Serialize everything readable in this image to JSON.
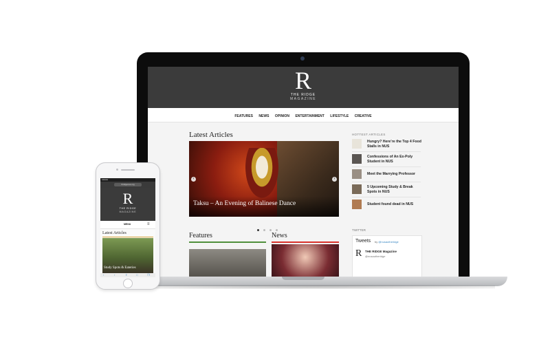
{
  "site": {
    "logo_letter": "R",
    "logo_title": "THE RIDGE",
    "logo_subtitle": "MAGAZINE"
  },
  "nav": [
    "FEATURES",
    "NEWS",
    "OPINION",
    "ENTERTAINMENT",
    "LIFESTYLE",
    "CREATIVE"
  ],
  "latest": {
    "heading": "Latest Articles",
    "hero_caption": "Taksu – An Evening of Balinese Dance",
    "prev_arrow": "‹",
    "next_arrow": "›",
    "slides": 4,
    "active_slide": 1
  },
  "sections": {
    "features": "Features",
    "news": "News"
  },
  "sidebar": {
    "hottest_heading": "HOTTEST ARTICLES",
    "hottest": [
      "Hungry? Here’re the Top 4 Food Stalls in NUS",
      "Confessions of An Ex-Poly Student in NUS",
      "Meet the Marrying Professor",
      "5 Upcoming Study & Break Spots in NUS",
      "Student found dead in NUS"
    ],
    "twitter_heading": "TWITTER",
    "tweets_title": "Tweets",
    "tweets_by": "by",
    "tweets_handle": "@nusautheridge",
    "tweet_logo": "R",
    "tweet_name": "THE RIDGE Magazine",
    "tweet_user": "@nusautheridge"
  },
  "phone": {
    "status_text": "●●●●●",
    "url": "thridgenus.org",
    "logo_letter": "R",
    "logo_title": "THE RIDGE",
    "logo_subtitle": "MAGAZINE",
    "menu_label": "MENU",
    "menu_icon": "≡",
    "latest_heading": "Latest Articles",
    "hero_caption": "Study Spots & Eateries"
  },
  "colors": {
    "header_bg": "#3b3b3b",
    "features_accent": "#4e8f3a",
    "news_accent": "#d8312a"
  }
}
